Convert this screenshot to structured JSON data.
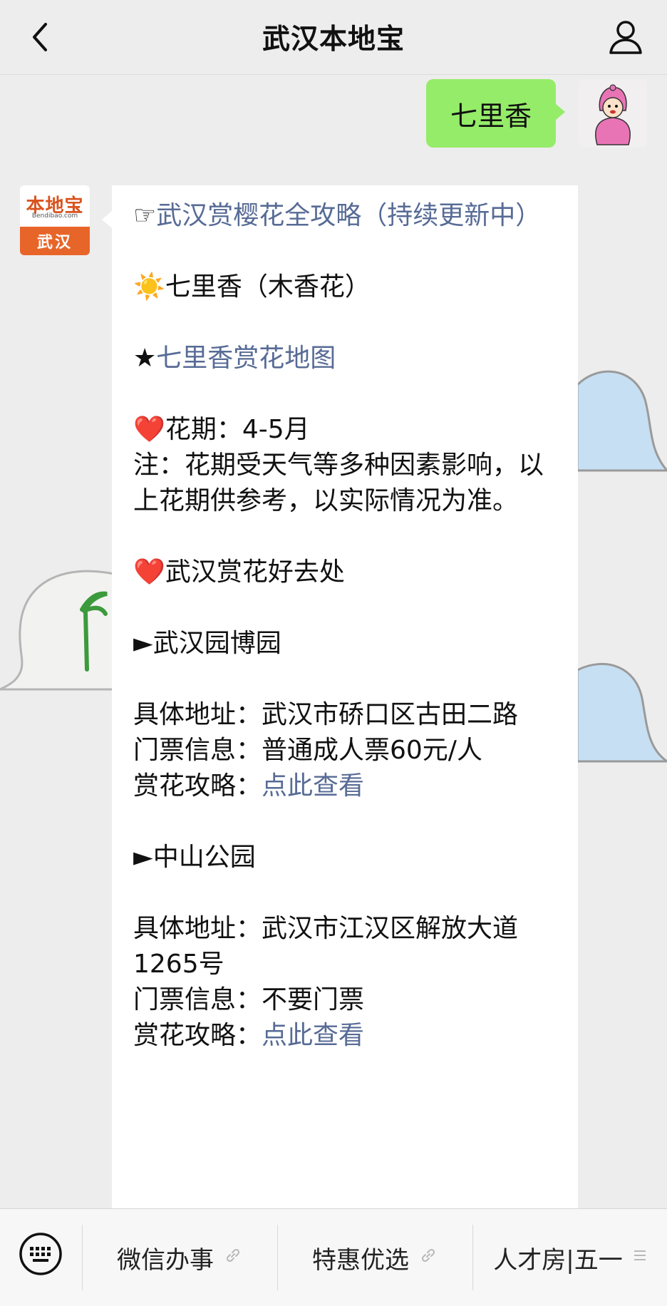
{
  "header": {
    "title": "武汉本地宝"
  },
  "outgoing": {
    "text": "七里香"
  },
  "bot_avatar": {
    "logo": "本地宝",
    "sub": "Bendibao.com",
    "city": "武汉"
  },
  "message": {
    "guide_prefix": "☞",
    "guide_link": "武汉赏樱花全攻略（持续更新中）",
    "flower_icon": "☀️",
    "flower_name": "七里香（木香花）",
    "map_star": "★",
    "map_link": "七里香赏花地图",
    "heart": "❤️",
    "period_label": "花期：4-5月",
    "note": "注：花期受天气等多种因素影响，以上花期供参考，以实际情况为准。",
    "places_title": "武汉赏花好去处",
    "places": [
      {
        "marker": "►",
        "name": "武汉园博园",
        "address": "具体地址：武汉市硚口区古田二路",
        "ticket": "门票信息：普通成人票60元/人",
        "guide_label": "赏花攻略：",
        "guide_link": "点此查看"
      },
      {
        "marker": "►",
        "name": "中山公园",
        "address": "具体地址：武汉市江汉区解放大道1265号",
        "ticket": "门票信息：不要门票",
        "guide_label": "赏花攻略：",
        "guide_link": "点此查看"
      }
    ]
  },
  "bottom_menu": {
    "items": [
      {
        "label": "微信办事",
        "icon": "link-icon"
      },
      {
        "label": "特惠优选",
        "icon": "link-icon"
      },
      {
        "label": "人才房|五一",
        "icon": "menu-lines-icon"
      }
    ]
  },
  "colors": {
    "bubble_out": "#95ec69",
    "link": "#576b95",
    "accent": "#e8652a"
  }
}
